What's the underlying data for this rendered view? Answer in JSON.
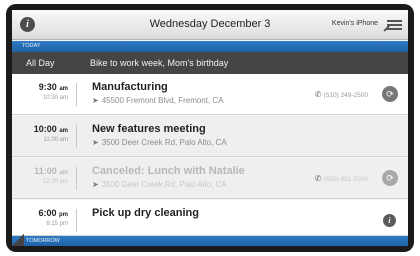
{
  "topbar": {
    "date": "Wednesday December 3",
    "device": "Kevin's iPhone"
  },
  "sections": {
    "today": "TODAY",
    "tomorrow": "TOMORROW"
  },
  "all_day": {
    "label": "All Day",
    "text": "Bike to work week, Mom's birthday"
  },
  "events": [
    {
      "start": "9:30",
      "start_suffix": "am",
      "end": "10:30 am",
      "title": "Manufacturing",
      "location": "45500 Fremont Blvd, Fremont, CA",
      "phone": "(510) 249-2500",
      "action_icon": "swap-icon"
    },
    {
      "start": "10:00",
      "start_suffix": "am",
      "end": "11:00 am",
      "title": "New features meeting",
      "location": "3500 Deer Creek Rd, Palo Alto, CA"
    },
    {
      "start": "11:00",
      "start_suffix": "am",
      "end": "12:30 pm",
      "title": "Canceled: Lunch with Natalie",
      "location": "3500 Deer Creek Rd, Palo Alto, CA",
      "phone": "(650) 681-5000",
      "action_icon": "swap-icon"
    },
    {
      "start": "6:00",
      "start_suffix": "pm",
      "end": "6:15 pm",
      "title": "Pick up dry cleaning",
      "action_icon": "info-icon"
    }
  ],
  "icons": {
    "info": "i",
    "location_arrow": "➤",
    "phone": "✆",
    "swap": "⟳"
  },
  "colors": {
    "accent_blue": "#1d5fa3",
    "allday_bg": "#454545",
    "frame": "#1b1b1b"
  }
}
